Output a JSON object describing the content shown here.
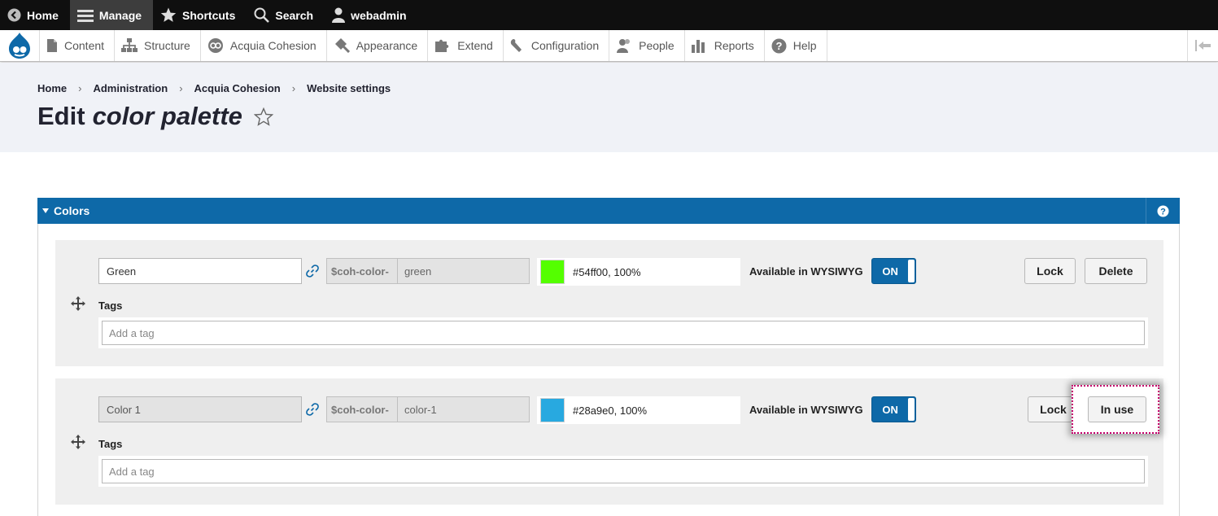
{
  "toolbar": {
    "home_label": "Home",
    "manage_label": "Manage",
    "shortcuts_label": "Shortcuts",
    "search_label": "Search",
    "user_label": "webadmin"
  },
  "admin_menu": {
    "items": [
      {
        "label": "Content",
        "icon": "document-icon"
      },
      {
        "label": "Structure",
        "icon": "structure-icon"
      },
      {
        "label": "Acquia Cohesion",
        "icon": "cohesion-icon"
      },
      {
        "label": "Appearance",
        "icon": "paintbrush-icon"
      },
      {
        "label": "Extend",
        "icon": "puzzle-icon"
      },
      {
        "label": "Configuration",
        "icon": "wrench-icon"
      },
      {
        "label": "People",
        "icon": "people-icon"
      },
      {
        "label": "Reports",
        "icon": "bar-chart-icon"
      },
      {
        "label": "Help",
        "icon": "help-icon"
      }
    ]
  },
  "breadcrumb": [
    "Home",
    "Administration",
    "Acquia Cohesion",
    "Website settings"
  ],
  "page": {
    "title_prefix": "Edit",
    "title_emphasis": "color palette"
  },
  "colors_panel": {
    "title": "Colors",
    "rows": [
      {
        "name": "Green",
        "variable_prefix": "$coh-color-",
        "variable_name": "green",
        "swatch_color": "#54ff00",
        "color_value": "#54ff00, 100%",
        "wysiwyg_label": "Available in WYSIWYG",
        "toggle_label": "ON",
        "lock_label": "Lock",
        "action_label": "Delete",
        "tags_label": "Tags",
        "tags_placeholder": "Add a tag"
      },
      {
        "name": "Color 1",
        "variable_prefix": "$coh-color-",
        "variable_name": "color-1",
        "swatch_color": "#28a9e0",
        "color_value": "#28a9e0, 100%",
        "wysiwyg_label": "Available in WYSIWYG",
        "toggle_label": "ON",
        "lock_label": "Lock",
        "action_label": "In use",
        "tags_label": "Tags",
        "tags_placeholder": "Add a tag"
      }
    ]
  },
  "colors": {
    "toolbar_bg": "#0f0f0f",
    "panel_header": "#0e69a8",
    "focus_outline": "#c4006b"
  }
}
